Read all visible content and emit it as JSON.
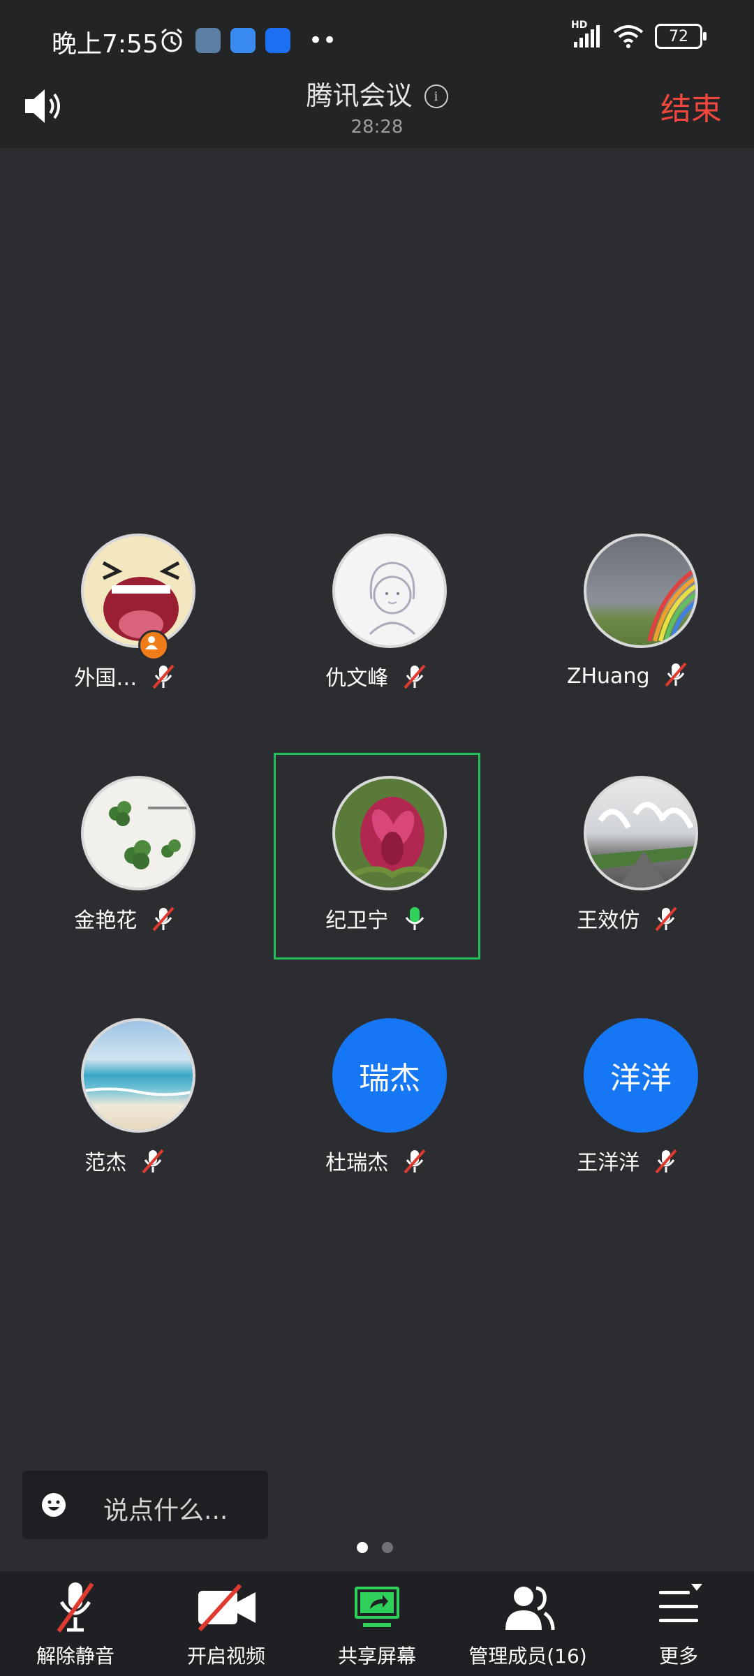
{
  "status_bar": {
    "time": "晚上7:55",
    "network": "HD",
    "battery": "72"
  },
  "header": {
    "title": "腾讯会议",
    "duration": "28:28",
    "end_label": "结束"
  },
  "participants": [
    {
      "name": "外国…",
      "mic": "muted",
      "avatar": "laughing-face",
      "host": true
    },
    {
      "name": "仇文峰",
      "mic": "muted",
      "avatar": "cartoon-girl"
    },
    {
      "name": "ZHuang",
      "mic": "muted",
      "avatar": "rainbow-photo"
    },
    {
      "name": "金艳花",
      "mic": "muted",
      "avatar": "clover-photo"
    },
    {
      "name": "纪卫宁",
      "mic": "speaking",
      "avatar": "flower-photo",
      "active": true
    },
    {
      "name": "王效仿",
      "mic": "muted",
      "avatar": "tree-road-photo"
    },
    {
      "name": "范杰",
      "mic": "muted",
      "avatar": "beach-photo"
    },
    {
      "name": "杜瑞杰",
      "mic": "muted",
      "avatar_text": "瑞杰"
    },
    {
      "name": "王洋洋",
      "mic": "muted",
      "avatar_text": "洋洋"
    }
  ],
  "chat": {
    "placeholder": "说点什么..."
  },
  "pager": {
    "pages": 2,
    "current": 1
  },
  "toolbar": {
    "unmute": "解除静音",
    "video": "开启视频",
    "share": "共享屏幕",
    "members": "管理成员(16)",
    "more": "更多"
  },
  "colors": {
    "background": "#2b2d31",
    "bar": "#1f2023",
    "end": "#f0483e",
    "accent_blue": "#1677f5",
    "speaking_green": "#2fd05a",
    "mute_red": "#e03a30"
  }
}
